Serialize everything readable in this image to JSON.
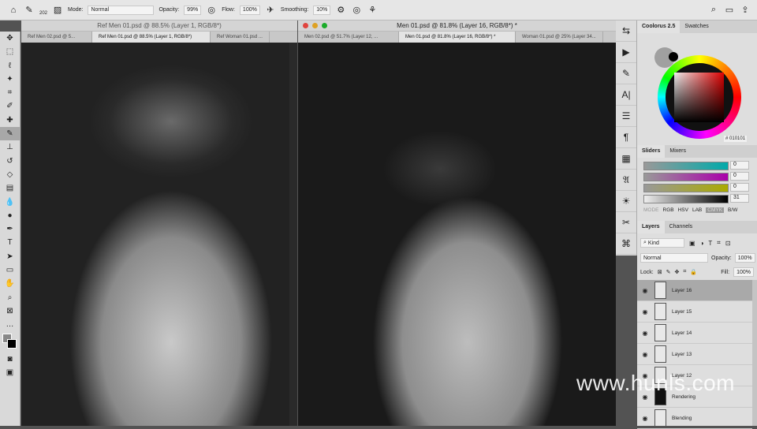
{
  "options_bar": {
    "brush_size": "202",
    "mode_label": "Mode:",
    "mode_value": "Normal",
    "opacity_label": "Opacity:",
    "opacity_value": "99%",
    "flow_label": "Flow:",
    "flow_value": "100%",
    "smoothing_label": "Smoothing:",
    "smoothing_value": "10%"
  },
  "left_window": {
    "title": "Ref Men 01.psd @ 88.5% (Layer 1, RGB/8*)",
    "tabs": [
      "Ref Men 02.psd @ 5...",
      "Ref Men 01.psd @ 88.5% (Layer 1, RGB/8*)",
      "Ref Woman 01.psd ..."
    ]
  },
  "right_window": {
    "title": "Men 01.psd @ 81.8% (Layer 16, RGB/8*) *",
    "tabs": [
      "Men 02.psd @ 51.7% (Layer 12, ...",
      "Men 01.psd @ 81.8% (Layer 16, RGB/8*) *",
      "Woman 01.psd @ 25% (Layer 34..."
    ]
  },
  "coolorus": {
    "tabs": [
      "Coolorus 2.5",
      "Swatches"
    ],
    "hex": "010101",
    "accent": "#010101"
  },
  "sliders": {
    "tabs": [
      "Sliders",
      "Mixers"
    ],
    "values": [
      "0",
      "0",
      "0",
      "31"
    ],
    "labels": [
      "C",
      "M",
      "Y",
      "K"
    ],
    "modes": [
      "MODE",
      "RGB",
      "HSV",
      "LAB",
      "CMYK",
      "B/W"
    ]
  },
  "layers": {
    "tabs": [
      "Layers",
      "Channels"
    ],
    "filter": "Kind",
    "blend": "Normal",
    "opacity_label": "Opacity:",
    "opacity": "100%",
    "lock_label": "Lock:",
    "fill_label": "Fill:",
    "fill": "100%",
    "items": [
      "Layer 16",
      "Layer 15",
      "Layer 14",
      "Layer 13",
      "Layer 12",
      "Rendering",
      "Blending"
    ]
  },
  "watermark": "www.hunls.com"
}
